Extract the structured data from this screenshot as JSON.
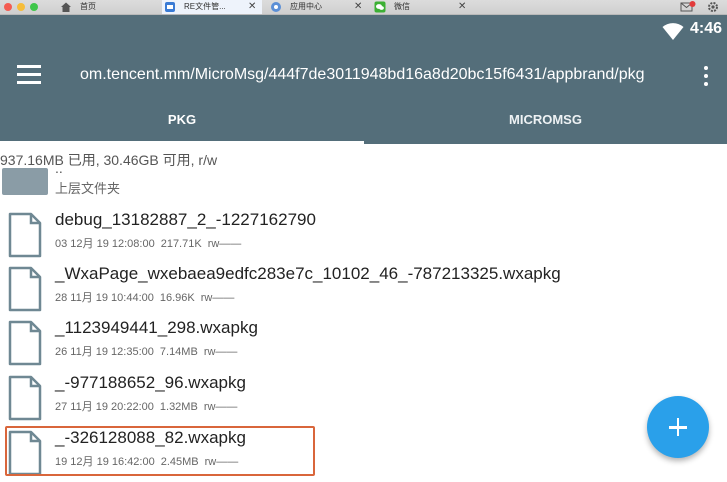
{
  "window_tabs": [
    {
      "label": "首页",
      "icon": "home-icon",
      "close": ""
    },
    {
      "label": "RE文件管...",
      "icon": "re-file-manager-icon",
      "close": "✕"
    },
    {
      "label": "应用中心",
      "icon": "app-center-icon",
      "close": "✕"
    },
    {
      "label": "微信",
      "icon": "wechat-icon",
      "close": "✕"
    }
  ],
  "notification_badge": "1",
  "status": {
    "time": "4:46"
  },
  "toolbar": {
    "path": "om.tencent.mm/MicroMsg/444f7de3011948bd16a8d20bc15f6431/appbrand/pkg"
  },
  "tabs": [
    {
      "label": "PKG",
      "active": true
    },
    {
      "label": "MICROMSG",
      "active": false
    }
  ],
  "storage_info": "937.16MB 已用, 30.46GB 可用, r/w",
  "parent": {
    "dots": "..",
    "label": "上层文件夹"
  },
  "files": [
    {
      "name": "debug_13182887_2_-1227162790",
      "date": "03 12月 19 12:08:00",
      "size": "217.71K",
      "perm": "rw——"
    },
    {
      "name": "_WxaPage_wxebaea9edfc283e7c_10102_46_-787213325.wxapkg",
      "date": "28 11月 19 10:44:00",
      "size": "16.96K",
      "perm": "rw——"
    },
    {
      "name": "_1123949441_298.wxapkg",
      "date": "26 11月 19 12:35:00",
      "size": "7.14MB",
      "perm": "rw——"
    },
    {
      "name": "_-977188652_96.wxapkg",
      "date": "27 11月 19 20:22:00",
      "size": "1.32MB",
      "perm": "rw——"
    },
    {
      "name": "_-326128088_82.wxapkg",
      "date": "19 12月 19 16:42:00",
      "size": "2.45MB",
      "perm": "rw——"
    }
  ],
  "colors": {
    "header": "#546e7a",
    "fab": "#2aa0ea",
    "highlight": "#d9663b"
  }
}
